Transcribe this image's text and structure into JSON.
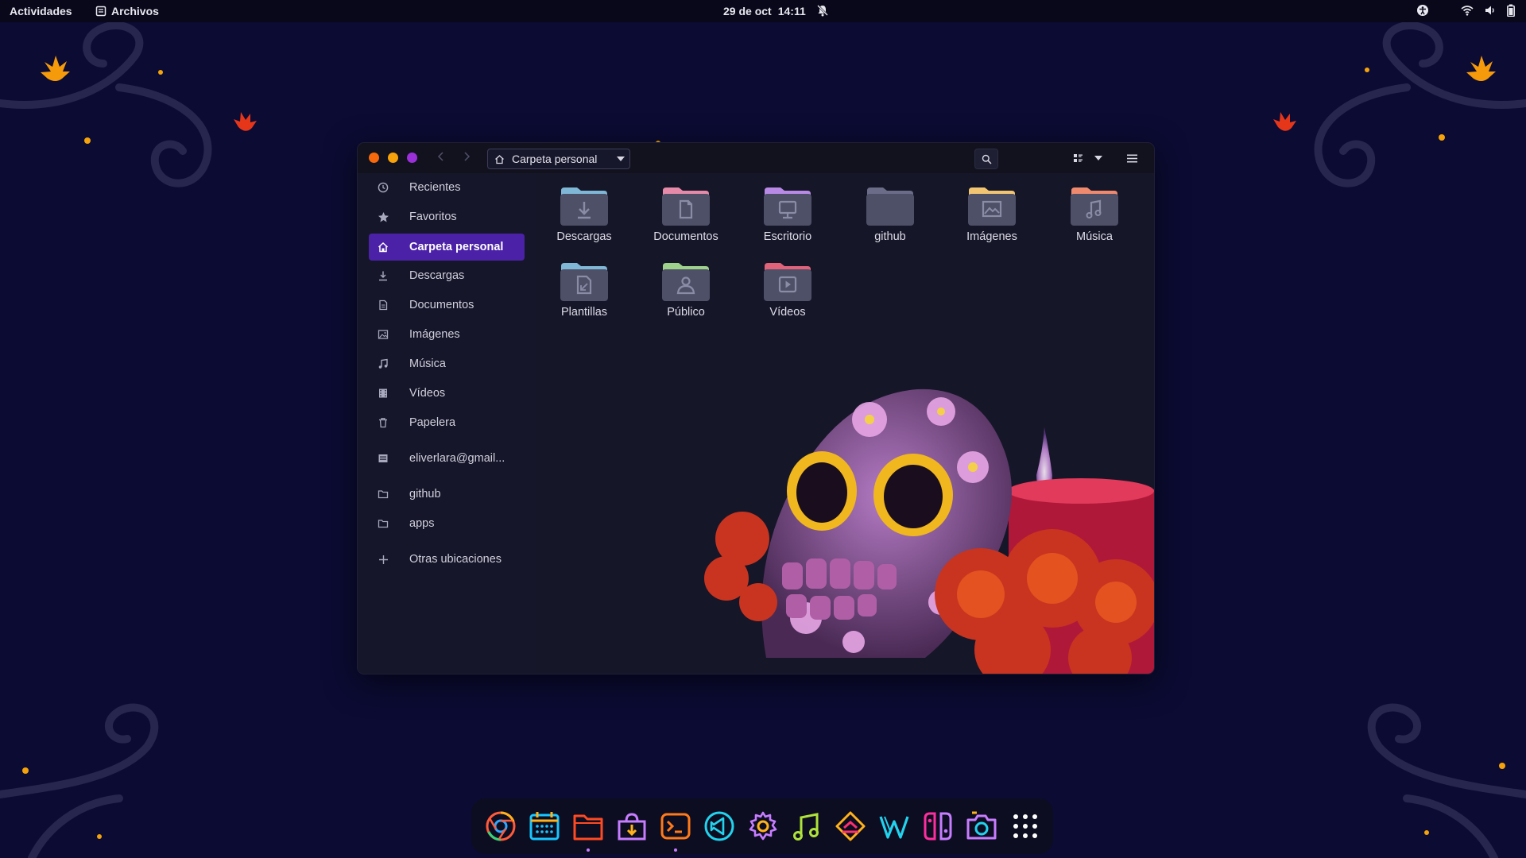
{
  "topbar": {
    "activities": "Actividades",
    "app_name": "Archivos",
    "date": "29 de oct",
    "time": "14:11"
  },
  "window": {
    "path_label": "Carpeta personal",
    "controls": {
      "close_color": "#f7690b",
      "minimize_color": "#f7a20b",
      "maximize_color": "#9b30d9"
    }
  },
  "sidebar": {
    "items": [
      {
        "label": "Recientes",
        "icon": "clock-icon"
      },
      {
        "label": "Favoritos",
        "icon": "star-icon"
      },
      {
        "label": "Carpeta personal",
        "icon": "home-icon",
        "active": true
      },
      {
        "label": "Descargas",
        "icon": "download-icon"
      },
      {
        "label": "Documentos",
        "icon": "document-icon"
      },
      {
        "label": "Imágenes",
        "icon": "image-icon"
      },
      {
        "label": "Música",
        "icon": "music-icon"
      },
      {
        "label": "Vídeos",
        "icon": "film-icon"
      },
      {
        "label": "Papelera",
        "icon": "trash-icon"
      },
      {
        "label": "eliverlara@gmail...",
        "icon": "account-icon"
      },
      {
        "label": "github",
        "icon": "folder-icon"
      },
      {
        "label": "apps",
        "icon": "folder-icon"
      },
      {
        "label": "Otras ubicaciones",
        "icon": "plus-icon"
      }
    ]
  },
  "folders": [
    {
      "name": "Descargas",
      "tab_color": "#7fb7d6",
      "glyph": "download-icon"
    },
    {
      "name": "Documentos",
      "tab_color": "#e58aa8",
      "glyph": "document-icon"
    },
    {
      "name": "Escritorio",
      "tab_color": "#b88ae6",
      "glyph": "monitor-icon"
    },
    {
      "name": "github",
      "tab_color": "#6a6c88",
      "glyph": "none"
    },
    {
      "name": "Imágenes",
      "tab_color": "#f2c572",
      "glyph": "image-icon"
    },
    {
      "name": "Música",
      "tab_color": "#ef8a6e",
      "glyph": "music-icon"
    },
    {
      "name": "Plantillas",
      "tab_color": "#7fb7d6",
      "glyph": "template-icon"
    },
    {
      "name": "Público",
      "tab_color": "#9ed28a",
      "glyph": "person-icon"
    },
    {
      "name": "Vídeos",
      "tab_color": "#e0637a",
      "glyph": "play-icon"
    }
  ],
  "dock": {
    "apps": [
      "chrome-icon",
      "calendar-icon",
      "files-icon",
      "software-icon",
      "terminal-icon",
      "vscode-icon",
      "settings-icon",
      "music-icon",
      "git-icon",
      "writer-icon",
      "switch-icon",
      "camera-icon",
      "app-grid-icon"
    ],
    "running": [
      2,
      4
    ]
  }
}
